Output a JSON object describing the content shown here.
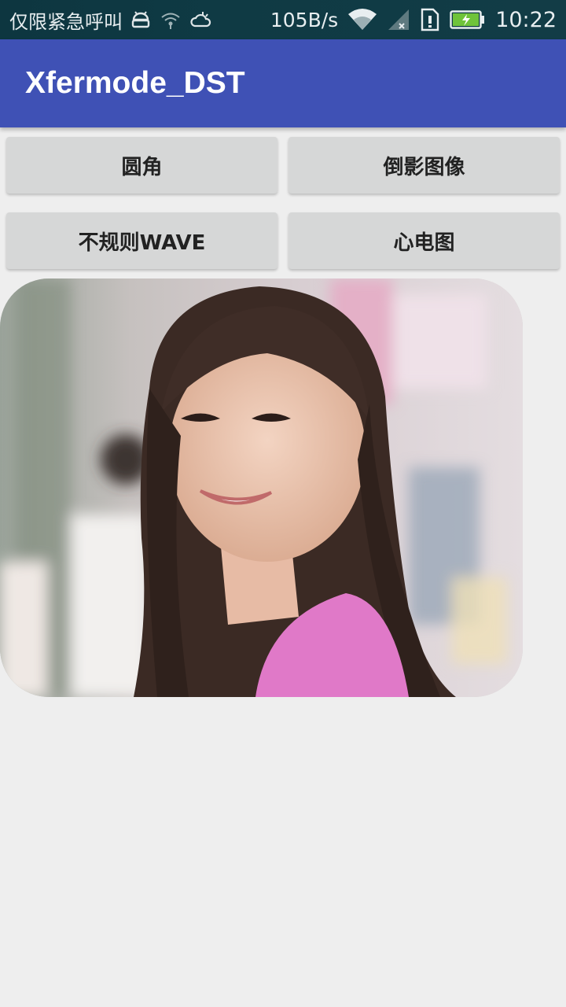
{
  "status_bar": {
    "carrier_text": "仅限紧急呼叫",
    "net_speed": "105B/s",
    "time": "10:22",
    "icons": [
      "android-debug-icon",
      "wifi-hotspot-icon",
      "weather-icon",
      "wifi-icon",
      "signal-icon",
      "sim-alert-icon",
      "battery-charging-icon"
    ]
  },
  "app_bar": {
    "title": "Xfermode_DST",
    "color": "#3f51b5"
  },
  "buttons": [
    {
      "label": "圆角"
    },
    {
      "label": "倒影图像"
    },
    {
      "label": "不规则WAVE"
    },
    {
      "label": "心电图"
    }
  ],
  "image": {
    "subject": "photo-portrait",
    "shape": "rounded-corners"
  }
}
